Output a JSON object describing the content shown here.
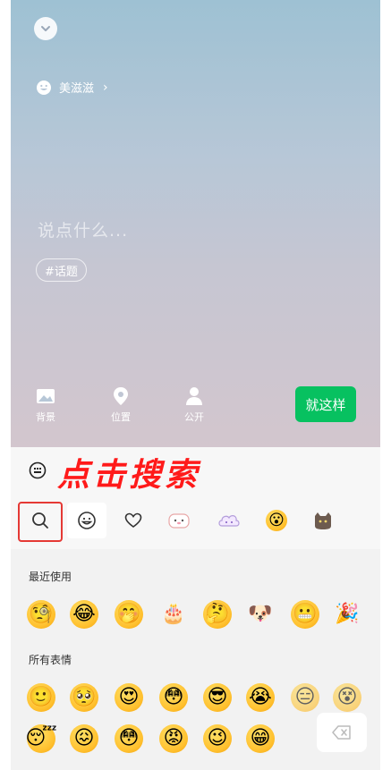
{
  "composer": {
    "filter_label": "美滋滋",
    "placeholder": "说点什么...",
    "topic_tag": "#话题",
    "toolbar": {
      "background_label": "背景",
      "location_label": "位置",
      "public_label": "公开"
    },
    "done_label": "就这样"
  },
  "annotation": {
    "text": "点击搜索"
  },
  "emoji_panel": {
    "tabs": [
      "search-icon",
      "smiley-icon",
      "heart-icon",
      "sticker-dog-icon",
      "sticker-cloud-icon",
      "sticker-emoji-icon",
      "sticker-cat-icon"
    ],
    "recent_title": "最近使用",
    "all_title": "所有表情",
    "recent": [
      "🧐",
      "😂",
      "🤭",
      "🎂",
      "🤔",
      "🐶",
      "😬",
      "🎉"
    ],
    "all_row1": [
      "🙂",
      "🥺",
      "😍",
      "😳",
      "😎",
      "😭",
      "😑",
      "😵"
    ],
    "all_row2": [
      "😴",
      "😖",
      "😳",
      "😡",
      "😉",
      "😁"
    ]
  },
  "colors": {
    "accent_green": "#07c160",
    "annotation_red": "#ff1a1a"
  }
}
